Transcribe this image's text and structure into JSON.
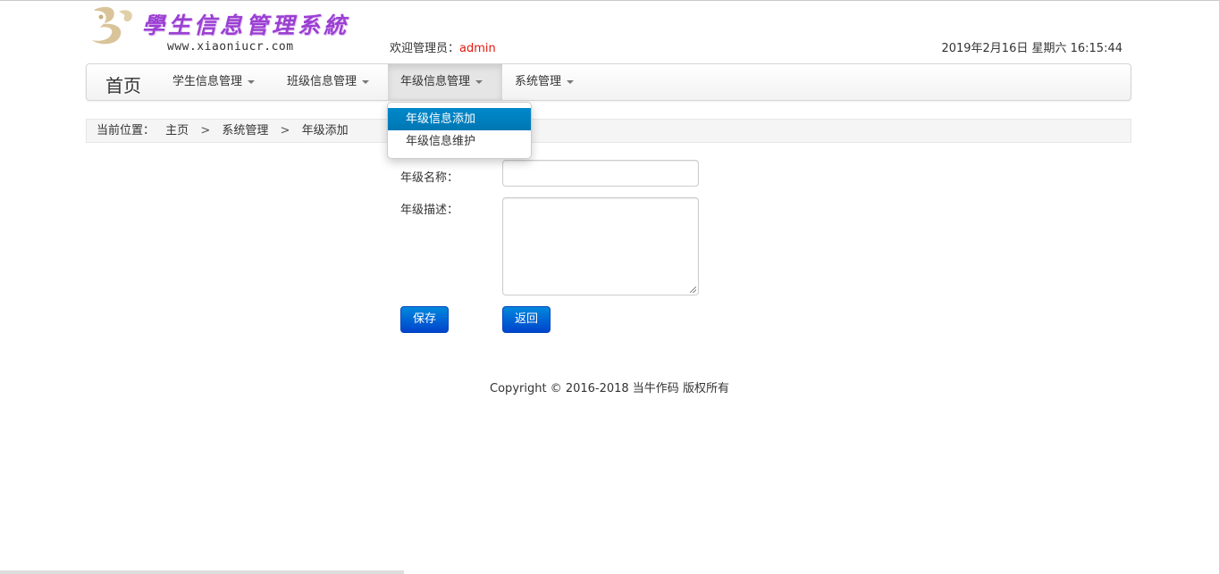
{
  "header": {
    "logo_title": "學生信息管理系統",
    "logo_url": "www.xiaoniucr.com",
    "welcome_prefix": "欢迎管理员：",
    "welcome_user": "admin",
    "datetime": "2019年2月16日 星期六 16:15:44"
  },
  "nav": {
    "brand": "首页",
    "items": [
      {
        "label": "学生信息管理"
      },
      {
        "label": "班级信息管理"
      },
      {
        "label": "年级信息管理"
      },
      {
        "label": "系统管理"
      }
    ],
    "dropdown": [
      {
        "label": "年级信息添加"
      },
      {
        "label": "年级信息维护"
      }
    ]
  },
  "breadcrumb": {
    "label": "当前位置：",
    "items": [
      "主页",
      "系统管理",
      "年级添加"
    ],
    "separator": ">"
  },
  "form": {
    "name_label": "年级名称：",
    "desc_label": "年级描述：",
    "name_value": "",
    "desc_value": "",
    "save_label": "保存",
    "back_label": "返回"
  },
  "footer": {
    "copyright": "Copyright © 2016-2018 当牛作码 版权所有"
  },
  "colors": {
    "accent": "#0088cc",
    "button": "#0055cc",
    "user": "#e3170d",
    "logo": "#9b3fd3"
  }
}
